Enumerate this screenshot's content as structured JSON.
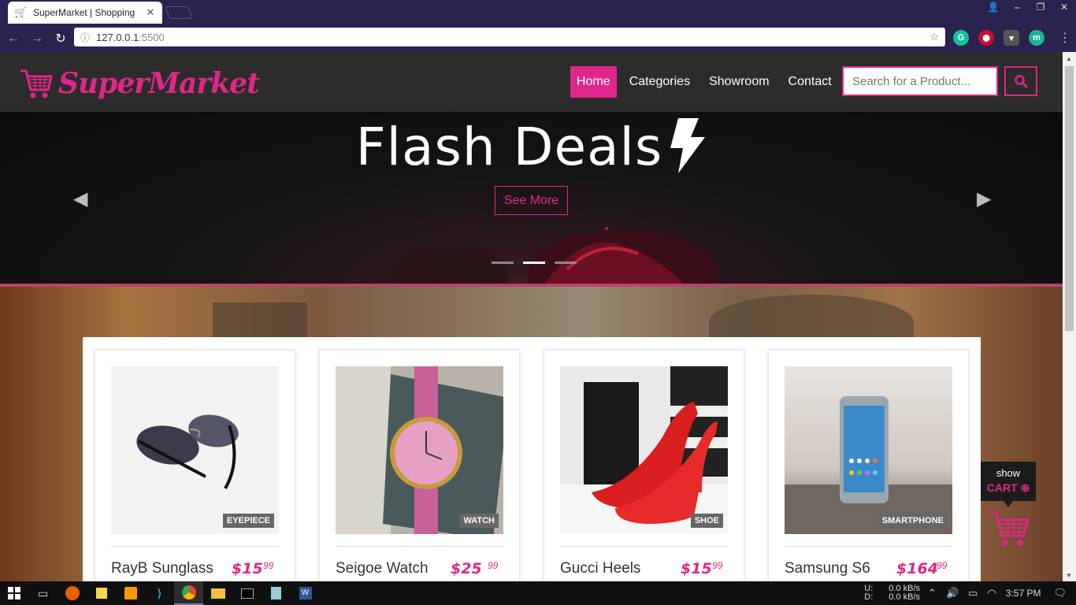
{
  "browser": {
    "tab_title": "SuperMarket | Shopping",
    "tab_close": "✕",
    "url_host": "127.0.0.1",
    "url_port": ":5500",
    "window_buttons": [
      "⎯",
      "❐",
      "✕"
    ]
  },
  "site": {
    "brand": "SuperMarket",
    "nav": [
      {
        "label": "Home",
        "active": true
      },
      {
        "label": "Categories"
      },
      {
        "label": "Showroom"
      },
      {
        "label": "Contact"
      }
    ],
    "search_placeholder": "Search for a Product...",
    "accent_color": "#e0268a"
  },
  "hero": {
    "headline": "Flash Deals",
    "button": "See More",
    "active_slide": 2,
    "slide_count": 3
  },
  "products": [
    {
      "name": "RayB Sunglass",
      "price": "$15",
      "cents": "99",
      "category": "EYEPIECE"
    },
    {
      "name": "Seigoe Watch",
      "price": "$25",
      "cents": "99",
      "category": "WATCH"
    },
    {
      "name": "Gucci Heels",
      "price": "$15",
      "cents": "99",
      "category": "SHOE"
    },
    {
      "name": "Samsung S6",
      "price": "$164",
      "cents": "99",
      "category": "SMARTPHONE"
    }
  ],
  "cart_widget": {
    "line1": "show",
    "line2": "CART"
  },
  "taskbar": {
    "net_up_label": "U:",
    "net_down_label": "D:",
    "net_up": "0.0 kB/s",
    "net_down": "0.0 kB/s",
    "time": "3:57 PM"
  }
}
